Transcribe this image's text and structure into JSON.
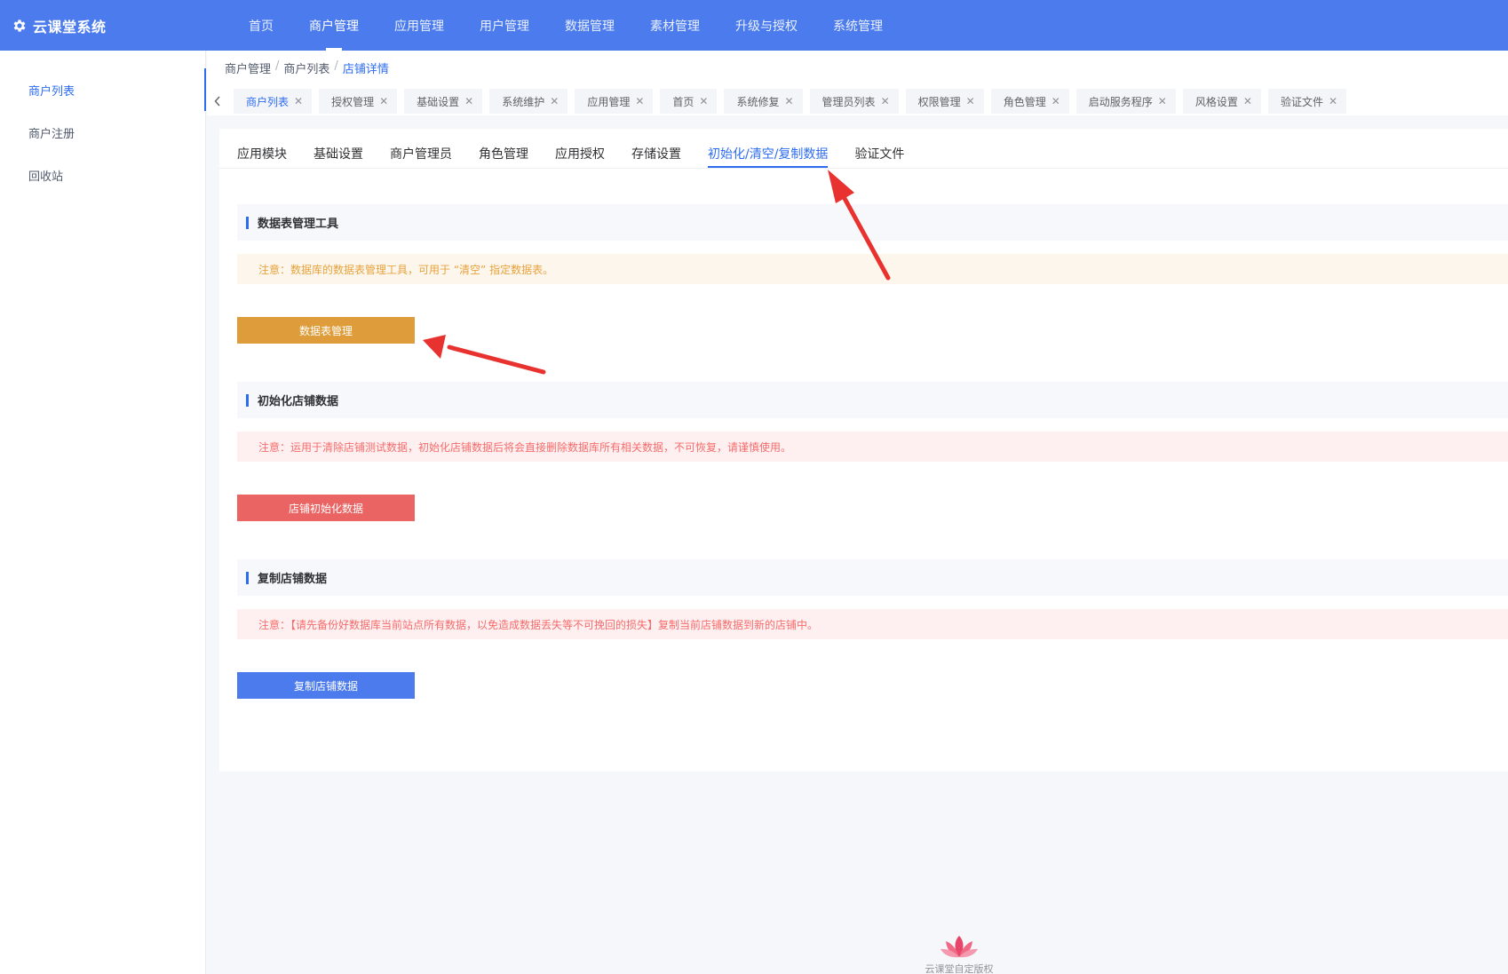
{
  "app": {
    "title": "云课堂系统"
  },
  "topnav": [
    "首页",
    "商户管理",
    "应用管理",
    "用户管理",
    "数据管理",
    "素材管理",
    "升级与授权",
    "系统管理"
  ],
  "sidebar": [
    "商户列表",
    "商户注册",
    "回收站"
  ],
  "breadcrumb": {
    "level1": "商户管理",
    "level2": "商户列表",
    "current": "店铺详情",
    "sep": "/"
  },
  "tabs": [
    "商户列表",
    "授权管理",
    "基础设置",
    "系统维护",
    "应用管理",
    "首页",
    "系统修复",
    "管理员列表",
    "权限管理",
    "角色管理",
    "启动服务程序",
    "风格设置",
    "验证文件"
  ],
  "subtabs": [
    "应用模块",
    "基础设置",
    "商户管理员",
    "角色管理",
    "应用授权",
    "存储设置",
    "初始化/清空/复制数据",
    "验证文件"
  ],
  "sections": [
    {
      "title": "数据表管理工具",
      "notice": "注意：数据库的数据表管理工具，可用于 “清空” 指定数据表。",
      "button": "数据表管理"
    },
    {
      "title": "初始化店铺数据",
      "notice": "注意：运用于清除店铺测试数据，初始化店铺数据后将会直接删除数据库所有相关数据，不可恢复，请谨慎使用。",
      "button": "店铺初始化数据"
    },
    {
      "title": "复制店铺数据",
      "notice": "注意：【请先备份好数据库当前站点所有数据，以免造成数据丢失等不可挽回的损失】复制当前店铺数据到新的店铺中。",
      "button": "复制店铺数据"
    }
  ],
  "footer": {
    "copyright": "云课堂自定版权"
  },
  "icons": {
    "logo": "gear-icon",
    "tab_close": "close-icon",
    "tab_prev": "chevron-left-icon",
    "footer_logo": "lotus-logo-icon"
  },
  "colors": {
    "primary": "#4b7bec",
    "warning_button": "#de9d3a",
    "danger_button": "#ea6464",
    "annotation_arrow": "#e8322f"
  }
}
